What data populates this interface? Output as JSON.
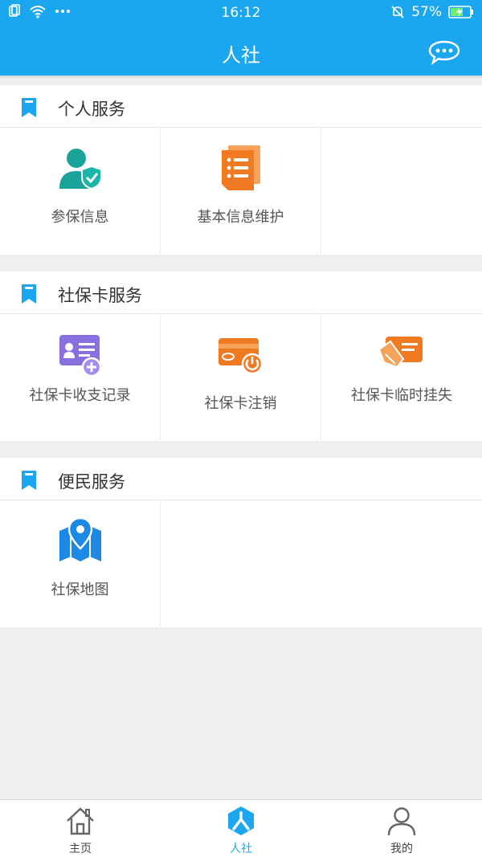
{
  "status_bar": {
    "time": "16:12",
    "battery": "57%"
  },
  "header": {
    "title": "人社"
  },
  "sections": [
    {
      "title": "个人服务",
      "items": [
        {
          "label": "参保信息"
        },
        {
          "label": "基本信息维护"
        }
      ]
    },
    {
      "title": "社保卡服务",
      "items": [
        {
          "label": "社保卡收支记录"
        },
        {
          "label": "社保卡注销"
        },
        {
          "label": "社保卡临时挂失"
        }
      ]
    },
    {
      "title": "便民服务",
      "items": [
        {
          "label": "社保地图"
        }
      ]
    }
  ],
  "tabbar": {
    "items": [
      {
        "label": "主页"
      },
      {
        "label": "人社"
      },
      {
        "label": "我的"
      }
    ],
    "active_index": 1
  },
  "colors": {
    "accent": "#1ba7f0",
    "teal": "#1aa39a",
    "orange": "#f07a22",
    "purple": "#8a6fe0",
    "blue_map": "#1e88e5"
  },
  "icons": {
    "status_left": [
      "sim-icon",
      "wifi-icon",
      "more-icon"
    ],
    "status_right": [
      "mute-bell-icon",
      "battery-icon"
    ],
    "header_right": "chat-icon",
    "items": [
      "user-shield-icon",
      "document-list-icon",
      "id-card-add-icon",
      "card-power-icon",
      "card-hand-icon",
      "map-pin-icon"
    ],
    "tabs": [
      "home-icon",
      "hexagon-person-icon",
      "person-icon"
    ]
  }
}
